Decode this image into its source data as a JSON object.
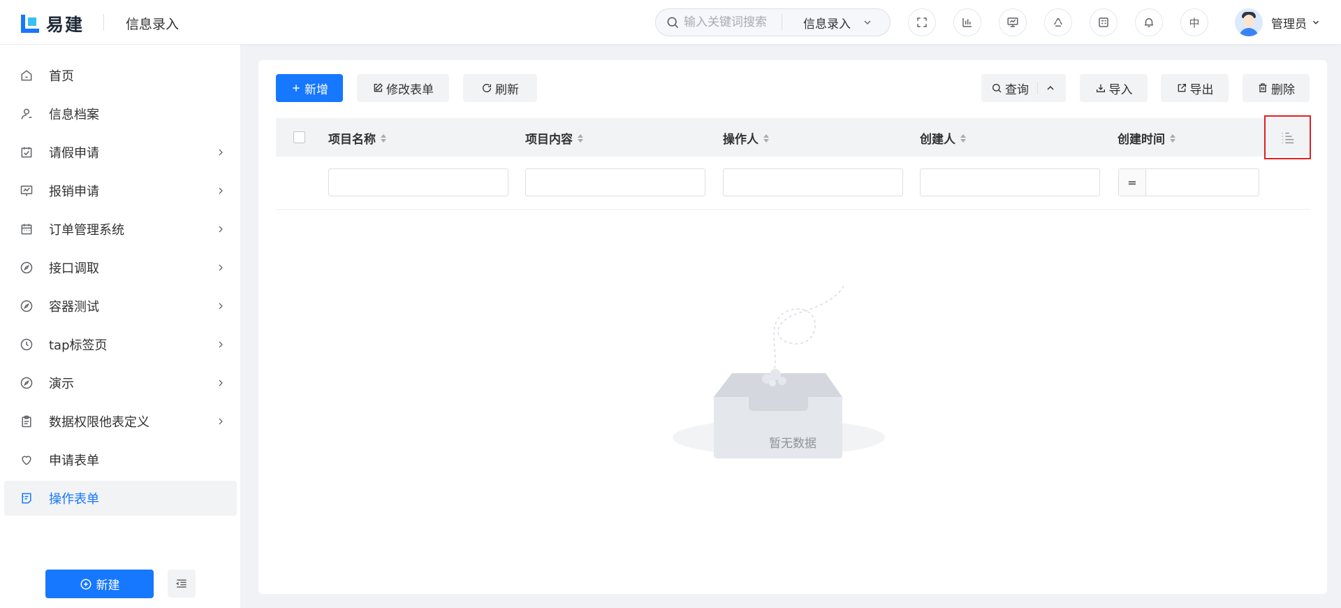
{
  "header": {
    "logo_text": "易建",
    "page_crumb": "信息录入",
    "search_placeholder": "输入关键词搜索",
    "search_scope": "信息录入",
    "lang_label": "中",
    "user_name": "管理员"
  },
  "sidebar": {
    "items": [
      {
        "label": "首页",
        "icon": "home-icon"
      },
      {
        "label": "信息档案",
        "icon": "user-icon"
      },
      {
        "label": "请假申请",
        "icon": "calendar-check-icon"
      },
      {
        "label": "报销申请",
        "icon": "chart-board-icon"
      },
      {
        "label": "订单管理系统",
        "icon": "calendar-icon"
      },
      {
        "label": "接口调取",
        "icon": "compass-icon"
      },
      {
        "label": "容器测试",
        "icon": "compass-icon"
      },
      {
        "label": "tap标签页",
        "icon": "clock-icon"
      },
      {
        "label": "演示",
        "icon": "compass-icon"
      },
      {
        "label": "数据权限他表定义",
        "icon": "clipboard-icon"
      },
      {
        "label": "申请表单",
        "icon": "heart-icon"
      },
      {
        "label": "操作表单",
        "icon": "form-icon"
      }
    ],
    "new_button": "新建"
  },
  "toolbar": {
    "add": "新增",
    "edit": "修改表单",
    "refresh": "刷新",
    "query": "查询",
    "import": "导入",
    "export": "导出",
    "delete": "删除"
  },
  "table": {
    "columns": [
      "项目名称",
      "项目内容",
      "操作人",
      "创建人",
      "创建时间"
    ],
    "eq_operator": "=",
    "empty_text": "暂无数据"
  },
  "colors": {
    "primary": "#1677ff",
    "highlight_border": "#e02020"
  }
}
